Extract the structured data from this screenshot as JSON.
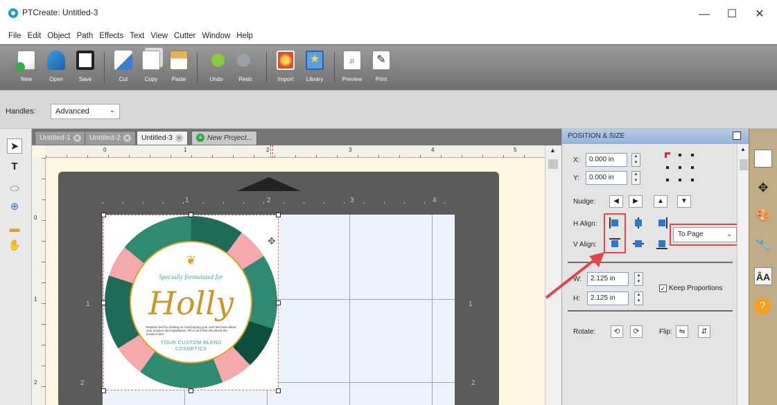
{
  "window": {
    "title": "PTCreate: Untitled-3",
    "minimize": "—",
    "maximize": "☐",
    "close": "✕"
  },
  "menu": [
    "File",
    "Edit",
    "Object",
    "Path",
    "Effects",
    "Text",
    "View",
    "Cutter",
    "Window",
    "Help"
  ],
  "toolbar": {
    "new": "New",
    "open": "Open",
    "save": "Save",
    "cut": "Cut",
    "copy": "Copy",
    "paste": "Paste",
    "undo": "Undo",
    "redo": "Redo",
    "import": "Import",
    "library": "Library",
    "preview": "Preview",
    "print": "Print"
  },
  "handles": {
    "label": "Handles:",
    "value": "Advanced",
    "chevron": "⌄"
  },
  "tabs": [
    {
      "label": "Untitled-1",
      "close": "✕"
    },
    {
      "label": "Untitled-2",
      "close": "✕"
    },
    {
      "label": "Untitled-3",
      "close": "✕"
    },
    {
      "label": "New Project...",
      "plus": "+"
    }
  ],
  "rulers": {
    "top": [
      "0",
      "1",
      "2",
      "3",
      "4",
      "5"
    ],
    "left": [
      "0",
      "1",
      "2"
    ]
  },
  "mat": {
    "top": [
      "1",
      "2",
      "3",
      "4"
    ],
    "left": [
      "1",
      "2"
    ],
    "right": [
      "1",
      "2"
    ]
  },
  "sticker": {
    "line1": "Specially formulated for",
    "name": "Holly",
    "small_text": "Replace text by clicking on it and typing your own text here about your product and ingredients. Fill in all of the info about the product here.",
    "line2": "YOUR CUSTOM BLEND",
    "line3": "COSMETICS",
    "lotus": "❦"
  },
  "panel": {
    "title": "POSITION & SIZE",
    "x_label": "X:",
    "x_value": "0.000 in",
    "y_label": "Y:",
    "y_value": "0.000 in",
    "nudge_label": "Nudge:",
    "nudge": [
      "◀",
      "▶",
      "▲",
      "▼"
    ],
    "h_align_label": "H Align:",
    "v_align_label": "V Align:",
    "align_target": "To Page",
    "w_label": "W:",
    "w_value": "2.125 in",
    "h_label": "H:",
    "h_value": "2.125 in",
    "keep_proportions": "Keep Proportions",
    "keep_check": "✓",
    "rotate_label": "Rotate:",
    "flip_label": "Flip:"
  },
  "colors": {
    "accent": "#e0474c",
    "panel_header": "#a8c0e0",
    "mat": "#5b5b5b",
    "ring_gold": "#d9a521",
    "teal": "#3aa890"
  }
}
